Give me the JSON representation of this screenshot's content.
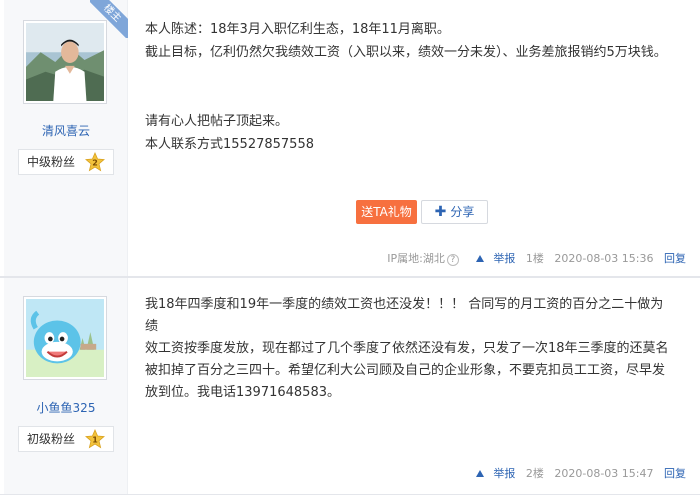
{
  "posts": [
    {
      "author": "清风喜云",
      "is_op": true,
      "op_tag": "楼主",
      "fan_level": "中级粉丝",
      "level_num": "2",
      "lines": [
        "本人陈述：18年3月入职亿利生态，18年11月离职。",
        "截止目标，亿利仍然欠我绩效工资（入职以来，绩效一分未发）、业务差旅报销约5万块钱。",
        "请有心人把帖子顶起来。",
        "本人联系方式15527857558"
      ],
      "gift_label": "送TA礼物",
      "share_label": "分享",
      "ip": "IP属地:湖北",
      "report": "举报",
      "floor": "1楼",
      "time": "2020-08-03 15:36",
      "reply": "回复"
    },
    {
      "author": "小鱼鱼325",
      "fan_level": "初级粉丝",
      "level_num": "1",
      "lines": [
        "我18年四季度和19年一季度的绩效工资也还没发！！！ 合同写的月工资的百分之二十做为绩",
        "效工资按季度发放，现在都过了几个季度了依然还没有发，只发了一次18年三季度的还莫名",
        "被扣掉了百分之三四十。希望亿利大公司顾及自己的企业形象，不要克扣员工工资，尽早发",
        "放到位。我电话13971648583。"
      ],
      "report": "举报",
      "floor": "2楼",
      "time": "2020-08-03 15:47",
      "reply": "回复"
    }
  ],
  "colors": {
    "link": "#2d64b3",
    "gift": "#f7703f",
    "op_tag": "#7fa6d9",
    "level_badge": "#f3c33c"
  }
}
